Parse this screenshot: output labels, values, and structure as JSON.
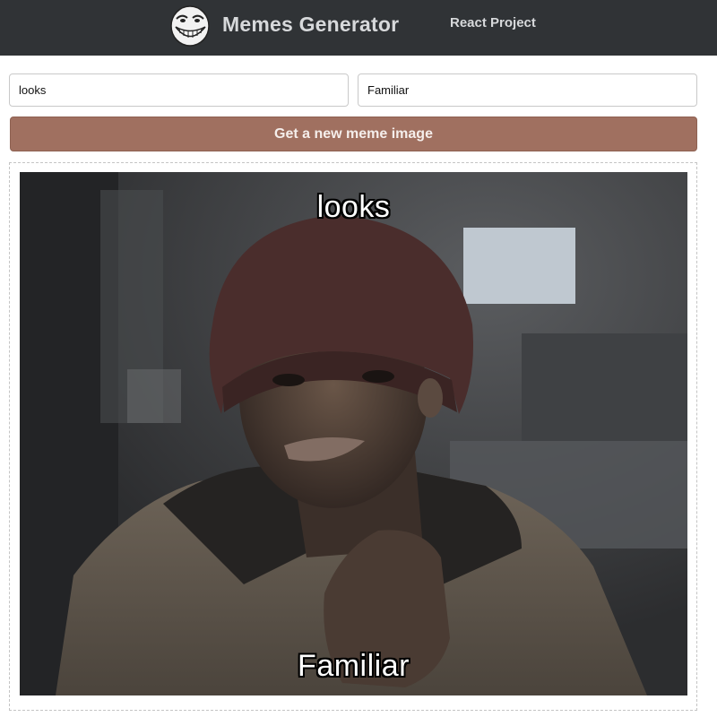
{
  "header": {
    "title": "Memes Generator",
    "subtitle": "React Project",
    "logo_icon": "trollface-icon",
    "background_color": "#303336"
  },
  "form": {
    "top_text": {
      "value": "looks"
    },
    "bottom_text": {
      "value": "Familiar"
    },
    "button_label": "Get a new meme image",
    "button_color": "#a07060"
  },
  "meme": {
    "top_caption": "looks",
    "bottom_caption": "Familiar"
  }
}
